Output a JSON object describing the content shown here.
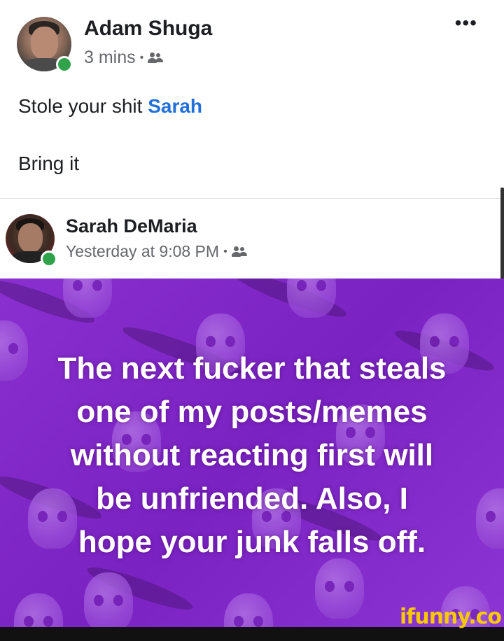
{
  "post": {
    "author": "Adam Shuga",
    "time": "3 mins",
    "separator": "•",
    "audience_icon": "friends-icon",
    "more_label": "•••",
    "line1_text": "Stole your shit ",
    "line1_mention": "Sarah",
    "line2_text": "Bring it"
  },
  "shared_post": {
    "author": "Sarah DeMaria",
    "time": "Yesterday at 9:08 PM",
    "separator": "•",
    "audience_icon": "friends-icon",
    "meme_lines": [
      "The next fucker that steals",
      "one of my posts/memes",
      "without reacting first will",
      "be unfriended. Also, I",
      "hope your junk falls off."
    ]
  },
  "watermark": "ifunny.co",
  "colors": {
    "mention": "#216fdb",
    "meme_background": "#7f28c8",
    "online": "#31a24c",
    "watermark": "#f6c900"
  }
}
